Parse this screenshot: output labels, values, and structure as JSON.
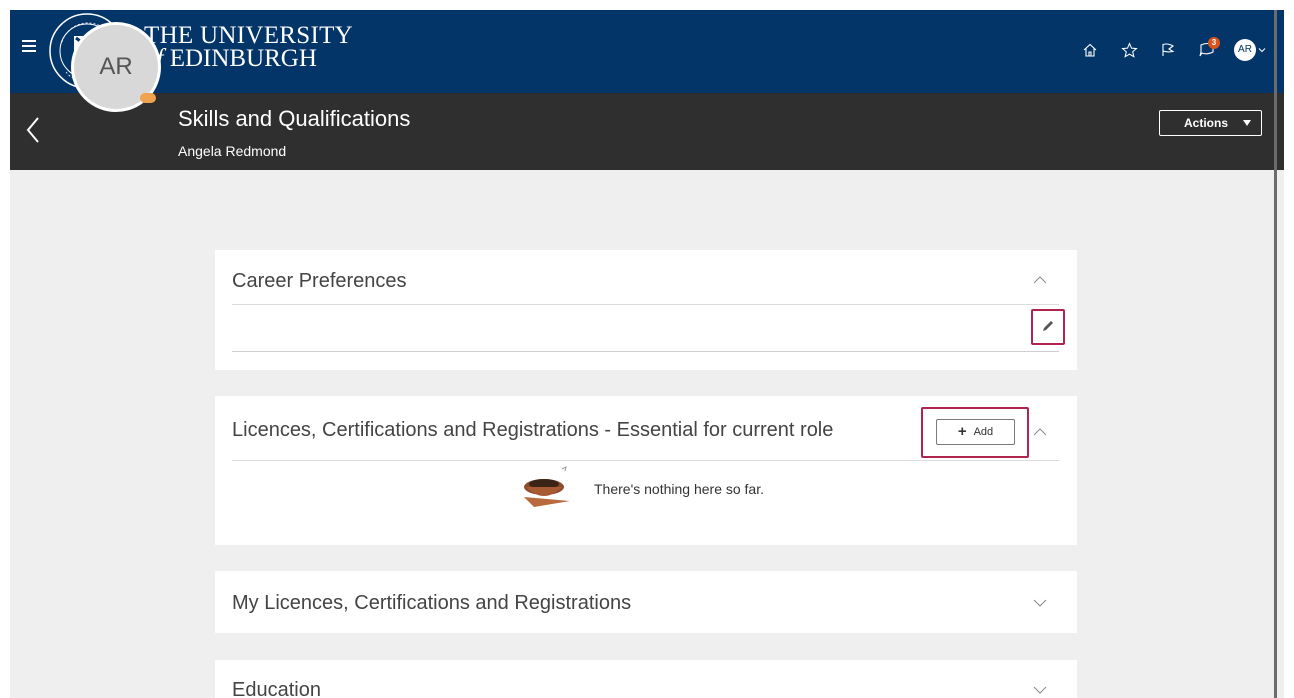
{
  "brand": {
    "line1": "THE UNIVERSITY",
    "line2_prefix": "of",
    "line2": "EDINBURGH"
  },
  "topbar": {
    "notification_count": "3",
    "user_initials": "AR",
    "icons": [
      "home-icon",
      "star-icon",
      "flag-icon",
      "notifications-icon"
    ]
  },
  "header": {
    "title": "Skills and Qualifications",
    "subtitle": "Angela Redmond",
    "avatar_initials": "AR",
    "actions_label": "Actions"
  },
  "sections": {
    "career": {
      "title": "Career Preferences"
    },
    "licences_essential": {
      "title": "Licences, Certifications and Registrations - Essential for current role",
      "add_label": "Add",
      "empty_text": "There's nothing here so far."
    },
    "my_licences": {
      "title": "My Licences, Certifications and Registrations"
    },
    "education": {
      "title": "Education"
    }
  },
  "colors": {
    "brand_blue": "#033568",
    "header_dark": "#2f2f2f",
    "highlight": "#b0244d",
    "notification": "#d9531e"
  }
}
